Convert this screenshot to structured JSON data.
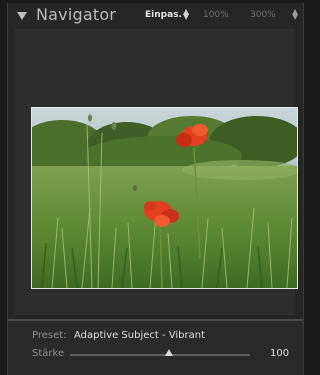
{
  "navigator": {
    "title": "Navigator",
    "zoom_options": [
      "Einpas.",
      "100%",
      "300%"
    ],
    "active_zoom": "Einpas."
  },
  "preset": {
    "label": "Preset:",
    "value": "Adaptive Subject - Vibrant"
  },
  "strength": {
    "label": "Stärke",
    "value": "100",
    "slider_fraction": 0.55
  },
  "icons": {
    "collapse": "triangle-down-icon",
    "fit_selector": "up-down-arrows-icon",
    "custom_zoom_selector": "up-down-arrows-icon"
  },
  "colors": {
    "panel_bg": "#262626",
    "preview_bg": "#2e2e2e",
    "text_active": "#e6e6e6",
    "text_dim": "#6f6f6f"
  }
}
